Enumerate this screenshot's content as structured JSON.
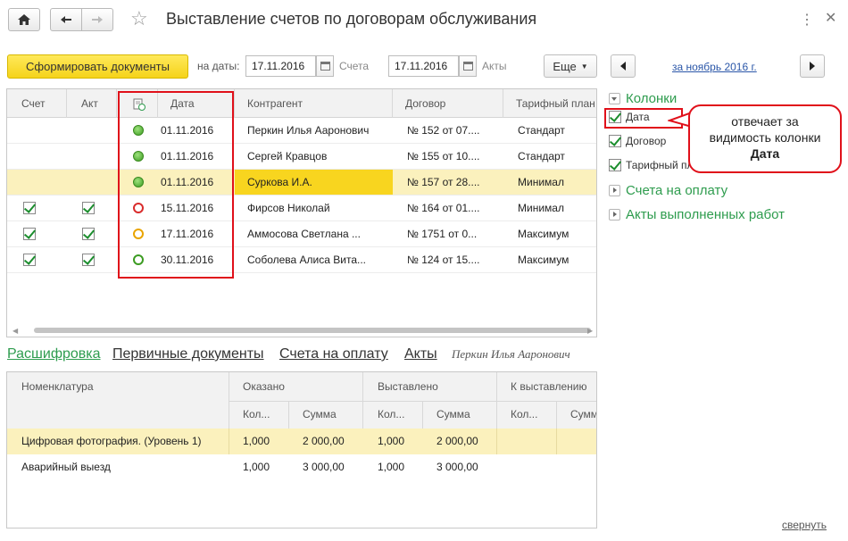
{
  "window": {
    "title": "Выставление счетов по договорам обслуживания"
  },
  "toolbar": {
    "generate_button": "Сформировать документы",
    "date_label": "на даты:",
    "invoices_date": "17.11.2016",
    "invoices_label": "Счета",
    "acts_date": "17.11.2016",
    "acts_label": "Акты",
    "more_button": "Еще"
  },
  "main_table": {
    "columns": [
      "Счет",
      "Акт",
      "Дата",
      "Контрагент",
      "Договор",
      "Тарифный план"
    ],
    "rows": [
      {
        "invoice": false,
        "act": false,
        "status": "green",
        "date": "01.11.2016",
        "counterparty": "Перкин Илья Ааронович",
        "contract": "№ 152 от 07....",
        "plan": "Стандарт",
        "selected": false
      },
      {
        "invoice": false,
        "act": false,
        "status": "green",
        "date": "01.11.2016",
        "counterparty": "Сергей Кравцов",
        "contract": "№ 155 от 10....",
        "plan": "Стандарт",
        "selected": false
      },
      {
        "invoice": false,
        "act": false,
        "status": "green",
        "date": "01.11.2016",
        "counterparty": "Суркова И.А.",
        "contract": "№ 157 от 28....",
        "plan": "Минимал",
        "selected": true
      },
      {
        "invoice": true,
        "act": true,
        "status": "red-ring",
        "date": "15.11.2016",
        "counterparty": "Фирсов Николай",
        "contract": "№ 164 от 01....",
        "plan": "Минимал",
        "selected": false
      },
      {
        "invoice": true,
        "act": true,
        "status": "orange-ring",
        "date": "17.11.2016",
        "counterparty": "Аммосова Светлана ...",
        "contract": "№ 1751 от 0...",
        "plan": "Максимум",
        "selected": false
      },
      {
        "invoice": true,
        "act": true,
        "status": "green-ring",
        "date": "30.11.2016",
        "counterparty": "Соболева Алиса Вита...",
        "contract": "№ 124 от 15....",
        "plan": "Максимум",
        "selected": false
      }
    ]
  },
  "links": {
    "decoding": "Расшифровка",
    "primary_docs": "Первичные документы",
    "invoices": "Счета на оплату",
    "acts": "Акты",
    "current_counterparty": "Перкин Илья Ааронович"
  },
  "details_table": {
    "col_nomenclature": "Номенклатура",
    "group_rendered": "Оказано",
    "group_issued": "Выставлено",
    "group_to_issue": "К выставлению",
    "sub_qty": "Кол...",
    "sub_sum": "Сумма",
    "sub_sum_cut": "Сумм",
    "rows": [
      {
        "name": "Цифровая фотография. (Уровень 1)",
        "rendered_qty": "1,000",
        "rendered_sum": "2 000,00",
        "issued_qty": "1,000",
        "issued_sum": "2 000,00",
        "selected": true
      },
      {
        "name": "Аварийный выезд",
        "rendered_qty": "1,000",
        "rendered_sum": "3 000,00",
        "issued_qty": "1,000",
        "issued_sum": "3 000,00",
        "selected": false
      }
    ]
  },
  "right_panel": {
    "period": "за ноябрь 2016 г.",
    "section_columns": "Колонки",
    "opt_date": "Дата",
    "opt_contract": "Договор",
    "opt_plan": "Тарифный пла...",
    "section_invoices": "Счета на оплату",
    "section_acts": "Акты выполненных работ",
    "collapse": "свернуть"
  },
  "callout": {
    "line1": "отвечает за",
    "line2": "видимость колонки",
    "line3": "Дата"
  },
  "colors": {
    "accent_yellow": "#f5d31a",
    "link_green": "#2e9c4e",
    "highlight_red": "#e0101a",
    "selected_row": "#fbf1bd"
  }
}
